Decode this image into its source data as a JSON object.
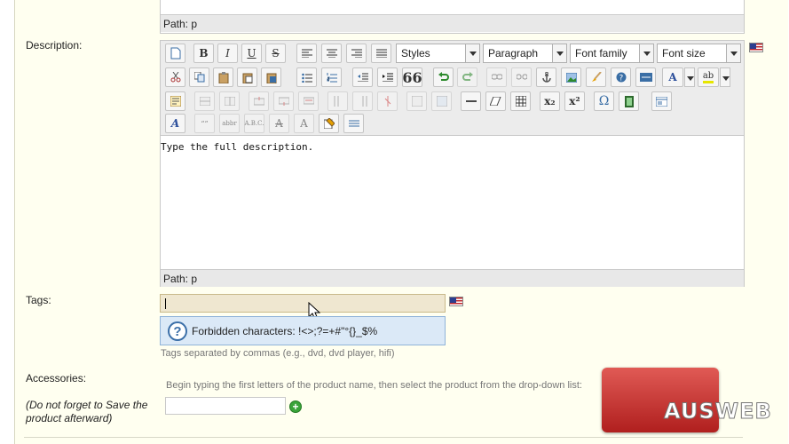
{
  "top_editor": {
    "path_label": "Path: p"
  },
  "description": {
    "label": "Description:",
    "toolbar": {
      "styles_label": "Styles",
      "format_label": "Paragraph",
      "font_family_label": "Font family",
      "font_size_label": "Font size",
      "bold_label": "B",
      "italic_label": "I",
      "underline_label": "U",
      "strike_label": "S",
      "blockquote_label": "66",
      "subscript_label": "x₂",
      "superscript_label": "x²",
      "omega_label": "Ω",
      "forecolor_label": "A",
      "backcolor_label": "ab",
      "styleprops_label": "A"
    },
    "content_text": "Type the full description.",
    "path_label": "Path: p"
  },
  "tags": {
    "label": "Tags:",
    "input_value": "",
    "hint_text": "Forbidden characters: !<>;?=+#\"°{}_$%",
    "help_text": "Tags separated by commas (e.g., dvd, dvd player, hifi)"
  },
  "accessories": {
    "label": "Accessories:",
    "note": "(Do not forget to Save the product afterward)",
    "instructions": "Begin typing the first letters of the product name, then select the product from the drop-down list:",
    "input_value": ""
  },
  "logo": {
    "text": "AUSWEB"
  },
  "colors": {
    "panel_bg": "#fffff0",
    "tag_input_bg": "#efe7d0",
    "hint_bg": "#dbe9f7",
    "logo_red": "#c8302c"
  }
}
